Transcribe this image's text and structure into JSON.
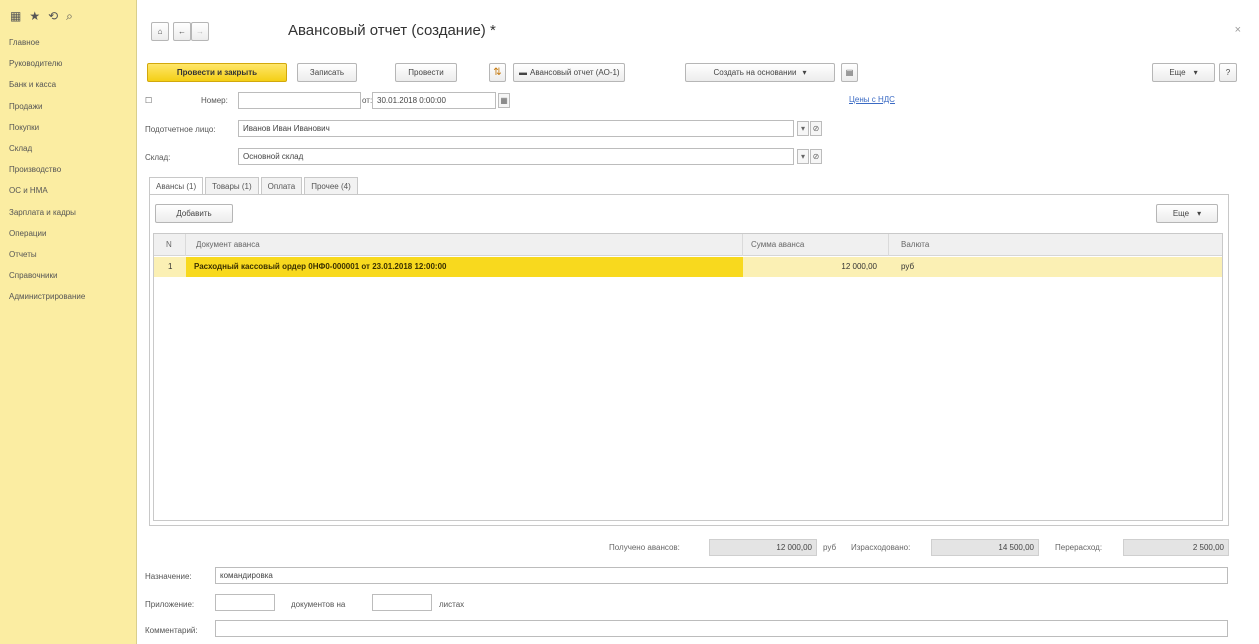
{
  "sidebar": {
    "top_icons": [
      "grid-icon",
      "star-icon",
      "history-icon",
      "search-icon"
    ],
    "items": [
      {
        "label": "Главное"
      },
      {
        "label": "Руководителю"
      },
      {
        "label": "Банк и касса"
      },
      {
        "label": "Продажи"
      },
      {
        "label": "Покупки"
      },
      {
        "label": "Склад"
      },
      {
        "label": "Производство"
      },
      {
        "label": "ОС и НМА"
      },
      {
        "label": "Зарплата и кадры"
      },
      {
        "label": "Операции"
      },
      {
        "label": "Отчеты"
      },
      {
        "label": "Справочники"
      },
      {
        "label": "Администрирование"
      }
    ]
  },
  "header": {
    "title": "Авансовый отчет (создание) *",
    "close": "×"
  },
  "toolbar": {
    "post_close": "Провести и закрыть",
    "save": "Записать",
    "post": "Провести",
    "print": "Авансовый отчет (АО-1)",
    "create_based": "Создать на основании",
    "more": "Еще",
    "help": "?"
  },
  "form": {
    "number_label": "Номер:",
    "number_value": "",
    "date_label": "от:",
    "date_value": "30.01.2018  0:00:00",
    "prices_link": "Цены с НДС",
    "person_label": "Подотчетное лицо:",
    "person_value": "Иванов Иван Иванович",
    "warehouse_label": "Склад:",
    "warehouse_value": "Основной склад"
  },
  "tabs": [
    {
      "label": "Авансы (1)"
    },
    {
      "label": "Товары (1)"
    },
    {
      "label": "Оплата"
    },
    {
      "label": "Прочее (4)"
    }
  ],
  "table": {
    "add_label": "Добавить",
    "more_label": "Еще",
    "columns": [
      "N",
      "Документ аванса",
      "Сумма аванса",
      "Валюта"
    ],
    "rows": [
      {
        "n": "1",
        "doc": "Расходный кассовый ордер 0НФ0-000001 от 23.01.2018 12:00:00",
        "sum": "12 000,00",
        "currency": "руб"
      }
    ]
  },
  "totals": {
    "received_label": "Получено авансов:",
    "received_value": "12 000,00",
    "received_currency": "руб",
    "spent_label": "Израсходовано:",
    "spent_value": "14 500,00",
    "overspent_label": "Перерасход:",
    "overspent_value": "2 500,00"
  },
  "footer": {
    "purpose_label": "Назначение:",
    "purpose_value": "командировка",
    "attachment_label": "Приложение:",
    "docs_on_label": "документов на",
    "sheets_label": "листах",
    "comment_label": "Комментарий:"
  }
}
